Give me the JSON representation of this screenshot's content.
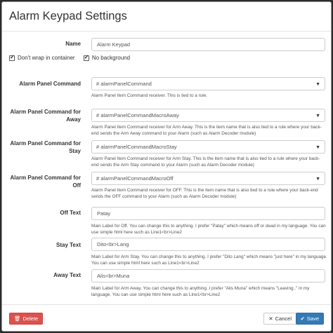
{
  "dialog": {
    "title": "Alarm Keypad Settings"
  },
  "name_field": {
    "label": "Name",
    "value": "Alarm Keypad"
  },
  "options": {
    "dont_wrap": "Don't wrap in container",
    "no_background": "No background"
  },
  "fields": [
    {
      "label": "Alarm Panel Command",
      "value": "# alarmPanelCommand",
      "help": "Alarm Panel Item Command receiver. This is tied to a rule."
    },
    {
      "label": "Alarm Panel Command for Away",
      "value": "# alarmPanelCommandMacroAway",
      "help": "Alarm Panel Item Command receiver for Arm Away. This is the item name that is also tied to a rule where your back-end sends the Arm Away command to your Alarm (such as Alarm Decoder module)"
    },
    {
      "label": "Alarm Panel Command for Stay",
      "value": "# alarmPanelCommandMacroStay",
      "help": "Alarm Panel Item Command receiver for Arm Stay. This is the item name that is also tied to a rule where your back-end sends the Arm Stay command to your Alarm (such as Alarm Decoder module)"
    },
    {
      "label": "Alarm Panel Command for Off",
      "value": "# alarmPanelCommandMacroOff",
      "help": "Alarm Panel Item Command receiver for OFF. This is the item name that is also tied to a rule where your back-end sends the OFF command to your Alarm (such as Alarm Decoder module)"
    }
  ],
  "texts": [
    {
      "label": "Off Text",
      "value": "Patay",
      "help": "Main Label for Off. You can change this to anything. I prefer \"Patay\" which means off or dead in my language. You can use simple html here such as Line1<br>Line2"
    },
    {
      "label": "Stay Text",
      "value": "Dito<br>Lang",
      "help": "Main Label for Arm Stay. You can change this to anything. I prefer \"Dito Lang\" which means \"just here\" in my language. You can use simple html here such as Line1<br>Line2"
    },
    {
      "label": "Away Text",
      "value": "Alis<br>Muna",
      "help": "Main Label for Arm Away. You can change this to anything. I prefer \"Alis Muna\" which means \"Leaving..\" in my language. You can use simple html here such as Line1<br>Line2"
    }
  ],
  "footer": {
    "delete_label": "Delete",
    "cancel_label": "Cancel",
    "save_label": "Save"
  },
  "colors": {
    "danger": "#d9534f",
    "primary": "#337ab7"
  }
}
